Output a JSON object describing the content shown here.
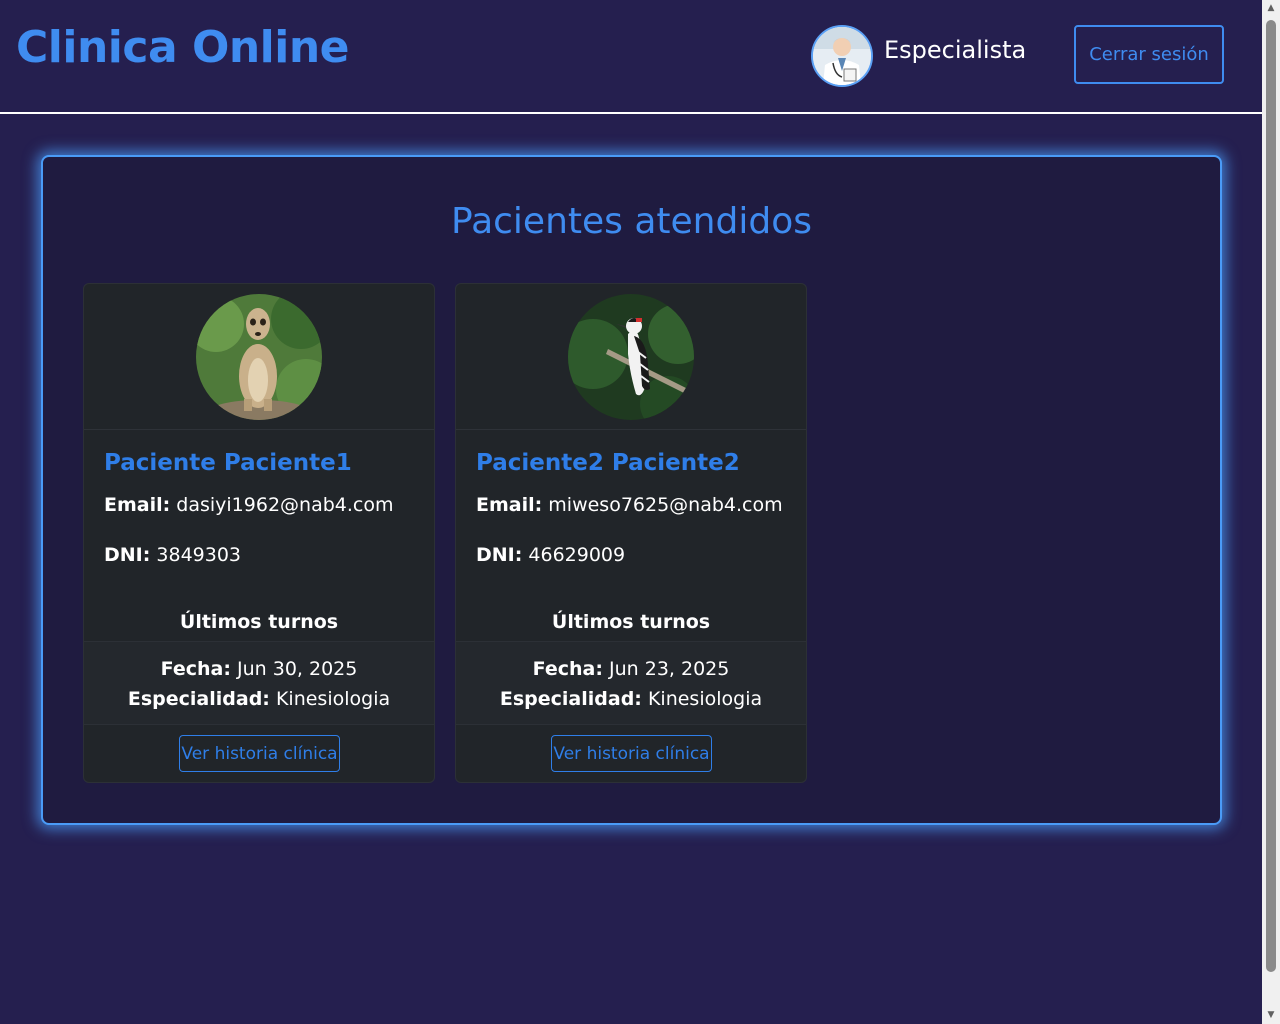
{
  "header": {
    "brand": "Clinica Online",
    "user_role": "Especialista",
    "logout_label": "Cerrar sesión"
  },
  "main": {
    "title": "Pacientes atendidos",
    "labels": {
      "email": "Email:",
      "dni": "DNI:",
      "turnos_title": "Últimos turnos",
      "fecha": "Fecha:",
      "especialidad": "Especialidad:",
      "history_button": "Ver historia clínica"
    },
    "patients": [
      {
        "name": "Paciente Paciente1",
        "email": "dasiyi1962@nab4.com",
        "dni": "3849303",
        "fecha": "Jun 30, 2025",
        "especialidad": "Kinesiologia",
        "avatar_icon": "meerkat-photo"
      },
      {
        "name": "Paciente2 Paciente2",
        "email": "miweso7625@nab4.com",
        "dni": "46629009",
        "fecha": "Jun 23, 2025",
        "especialidad": "Kinesiologia",
        "avatar_icon": "woodpecker-photo"
      }
    ]
  },
  "colors": {
    "background": "#251f4f",
    "accent": "#3f8cf0",
    "panel_glow": "#4a9bf7",
    "card_bg": "#212529"
  }
}
